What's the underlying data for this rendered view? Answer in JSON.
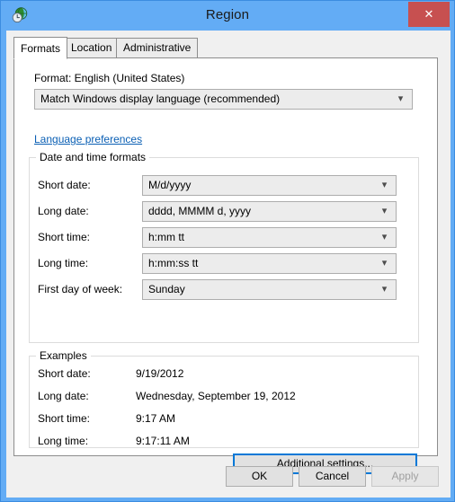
{
  "window": {
    "title": "Region",
    "icon": "globe-clock-icon",
    "close_label": "✕",
    "chrome_color": "#63ACF5",
    "close_color": "#C75050"
  },
  "tabs": [
    {
      "label": "Formats",
      "selected": true
    },
    {
      "label": "Location",
      "selected": false
    },
    {
      "label": "Administrative",
      "selected": false
    }
  ],
  "formats": {
    "format_label": "Format: English (United States)",
    "format_combo_value": "Match Windows display language (recommended)",
    "language_preferences_link": "Language preferences",
    "datetime_group": {
      "legend": "Date and time formats",
      "rows": [
        {
          "label": "Short date:",
          "value": "M/d/yyyy"
        },
        {
          "label": "Long date:",
          "value": "dddd, MMMM d, yyyy"
        },
        {
          "label": "Short time:",
          "value": "h:mm tt"
        },
        {
          "label": "Long time:",
          "value": "h:mm:ss tt"
        },
        {
          "label": "First day of week:",
          "value": "Sunday"
        }
      ]
    },
    "examples_group": {
      "legend": "Examples",
      "rows": [
        {
          "label": "Short date:",
          "value": "9/19/2012"
        },
        {
          "label": "Long date:",
          "value": "Wednesday, September 19, 2012"
        },
        {
          "label": "Short time:",
          "value": "9:17 AM"
        },
        {
          "label": "Long time:",
          "value": "9:17:11 AM"
        }
      ]
    },
    "additional_settings_label": "Additional settings..."
  },
  "footer": {
    "ok_label": "OK",
    "cancel_label": "Cancel",
    "apply_label": "Apply",
    "apply_enabled": false
  }
}
